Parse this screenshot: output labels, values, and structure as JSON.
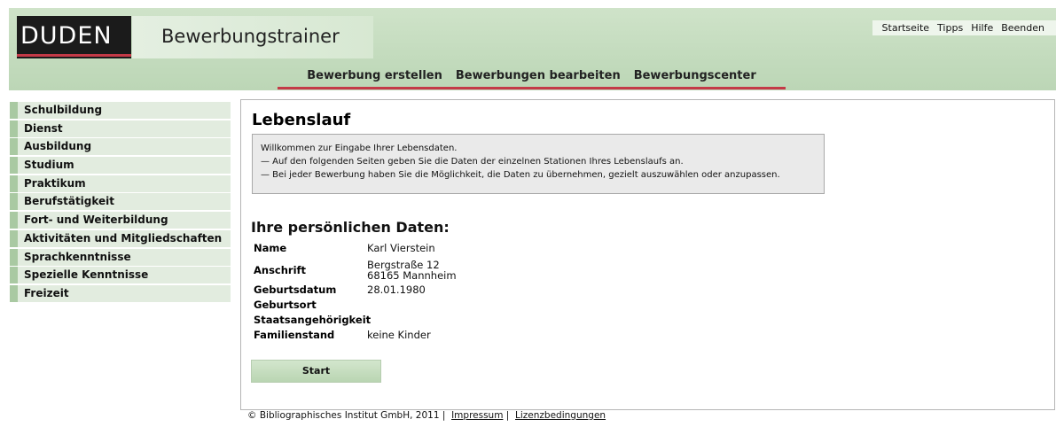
{
  "header": {
    "logo_text": "DUDEN",
    "app_title": "Bewerbungstrainer",
    "top_links": [
      "Startseite",
      "Tipps",
      "Hilfe",
      "Beenden"
    ],
    "main_nav": [
      "Bewerbung erstellen",
      "Bewerbungen bearbeiten",
      "Bewerbungscenter"
    ]
  },
  "sidebar": {
    "items": [
      "Schulbildung",
      "Dienst",
      "Ausbildung",
      "Studium",
      "Praktikum",
      "Berufstätigkeit",
      "Fort- und Weiterbildung",
      "Aktivitäten und Mitgliedschaften",
      "Sprachkenntnisse",
      "Spezielle Kenntnisse",
      "Freizeit"
    ]
  },
  "main": {
    "page_title": "Lebenslauf",
    "info_lines": [
      "Willkommen zur Eingabe Ihrer Lebensdaten.",
      "— Auf den folgenden Seiten geben Sie die Daten der einzelnen Stationen Ihres Lebenslaufs an.",
      "— Bei jeder Bewerbung haben Sie die Möglichkeit, die Daten zu übernehmen, gezielt auszuwählen oder anzupassen."
    ],
    "section_title": "Ihre persönlichen Daten:",
    "personal": {
      "name_label": "Name",
      "name_value": "Karl Vierstein",
      "address_label": "Anschrift",
      "address_line1": "Bergstraße 12",
      "address_line2": "68165 Mannheim",
      "birthdate_label": "Geburtsdatum",
      "birthdate_value": "28.01.1980",
      "birthplace_label": "Geburtsort",
      "birthplace_value": "",
      "nationality_label": "Staatsangehörigkeit",
      "nationality_value": "",
      "status_label": "Familienstand",
      "status_value": "keine Kinder"
    },
    "start_button": "Start"
  },
  "footer": {
    "copyright": "© Bibliographisches Institut GmbH, 2011 |",
    "separator": "|",
    "impressum": "Impressum",
    "license": "Lizenzbedingungen"
  },
  "colors": {
    "accent_red": "#c43a47",
    "header_green": "#c3dbbd",
    "sidebar_bar": "#a9c9a2"
  }
}
